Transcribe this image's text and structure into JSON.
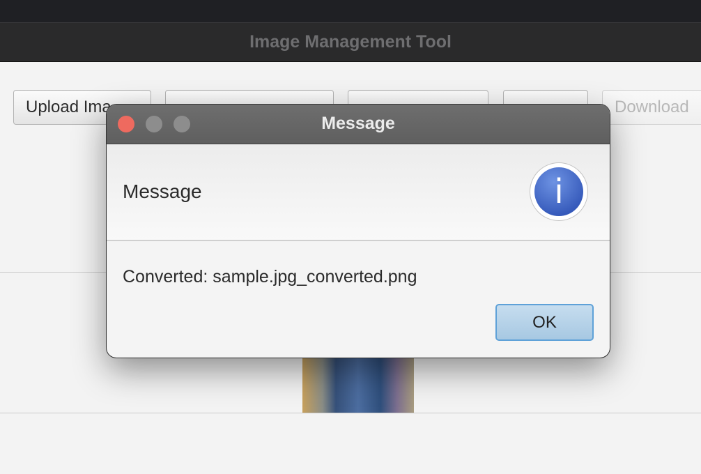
{
  "window": {
    "title": "Image Management Tool"
  },
  "toolbar": {
    "buttons": [
      {
        "label": "Upload Ima"
      },
      {
        "label": ""
      },
      {
        "label": ""
      },
      {
        "label": ""
      },
      {
        "label": "Download"
      }
    ]
  },
  "dialog": {
    "title": "Message",
    "heading": "Message",
    "icon": "info-icon",
    "info_glyph": "i",
    "message": "Converted: sample.jpg_converted.png",
    "ok_label": "OK"
  },
  "colors": {
    "close_light": "#ee6a5f",
    "info_blue": "#3f66c6",
    "ok_button": "#a7c8e2"
  }
}
